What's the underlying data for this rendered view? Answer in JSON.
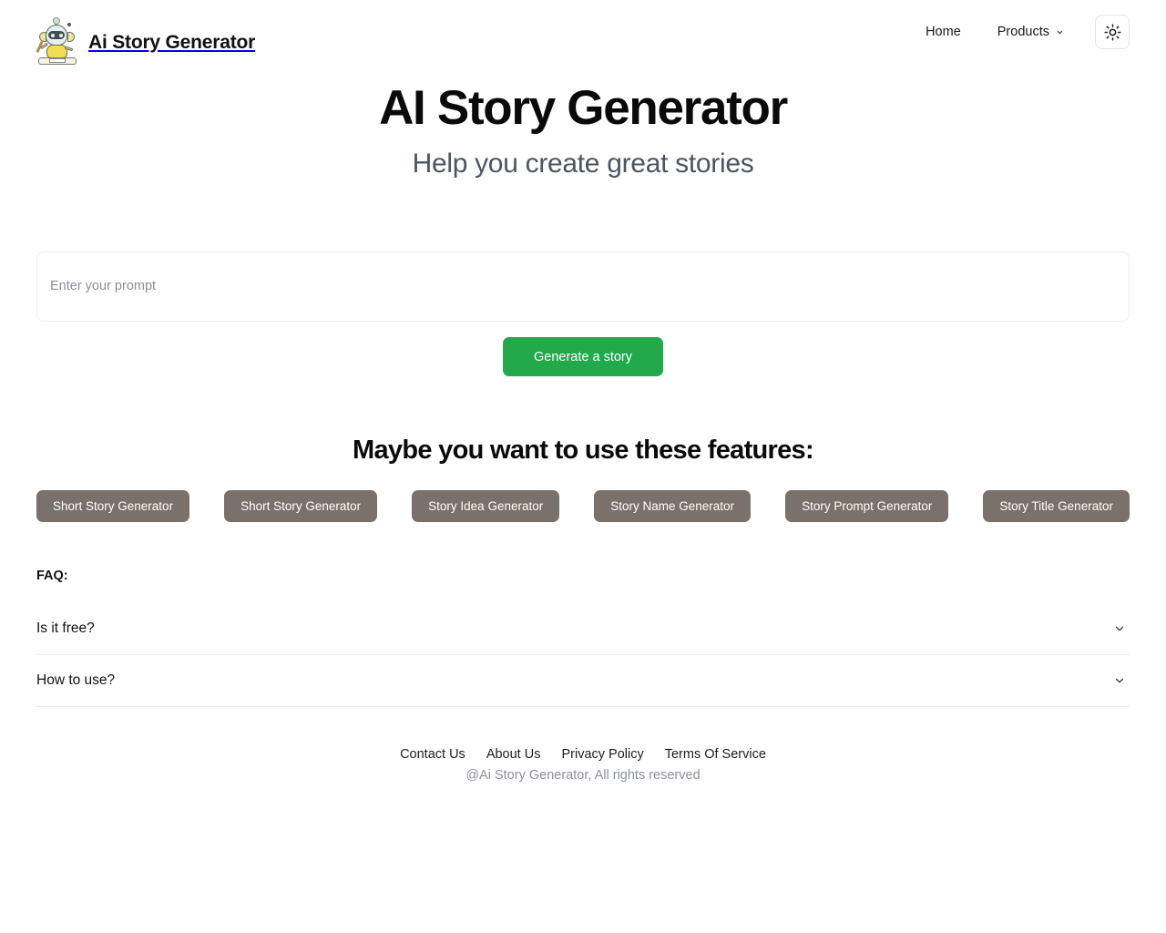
{
  "header": {
    "logo_icon": "robot-writing-icon",
    "brand_name": "Ai Story Generator",
    "nav": {
      "home_label": "Home",
      "products_label": "Products",
      "products_chevron_icon": "chevron-down-icon",
      "theme_toggle_icon": "sun-icon"
    }
  },
  "hero": {
    "title": "AI Story Generator",
    "subtitle": "Help you create great stories"
  },
  "prompt": {
    "placeholder": "Enter your prompt",
    "value": "",
    "generate_label": "Generate a story",
    "generate_color": "#21a94b"
  },
  "features": {
    "title": "Maybe you want to use these features:",
    "pill_color": "#79716a",
    "items": [
      {
        "label": "Short Story Generator"
      },
      {
        "label": "Short Story Generator"
      },
      {
        "label": "Story Idea Generator"
      },
      {
        "label": "Story Name Generator"
      },
      {
        "label": "Story Prompt Generator"
      },
      {
        "label": "Story Title Generator"
      }
    ]
  },
  "faq": {
    "label": "FAQ:",
    "expand_icon": "chevron-down-icon",
    "items": [
      {
        "question": "Is it free?"
      },
      {
        "question": "How to use?"
      }
    ]
  },
  "footer": {
    "links": [
      {
        "label": "Contact Us"
      },
      {
        "label": "About Us"
      },
      {
        "label": "Privacy Policy"
      },
      {
        "label": "Terms Of Service"
      }
    ],
    "copyright": "@Ai Story Generator, All rights reserved"
  }
}
